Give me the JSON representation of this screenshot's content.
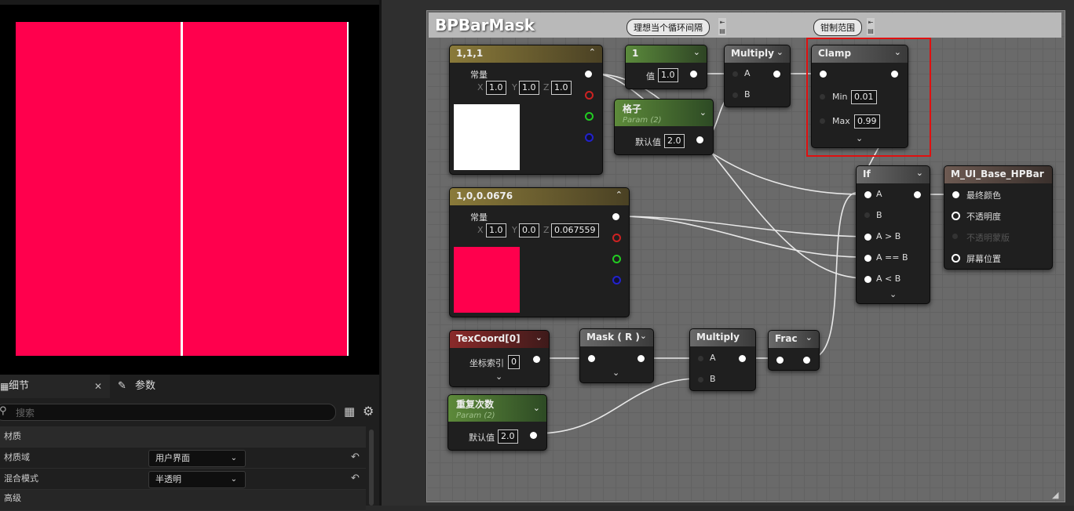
{
  "preview": {
    "fill_color": "#ff004d"
  },
  "details_panel": {
    "tabs": [
      {
        "label": "细节",
        "icon": "details-icon"
      },
      {
        "label": "参数",
        "icon": "pencil-icon"
      }
    ],
    "search_placeholder": "搜索",
    "section_header": "材质",
    "rows": [
      {
        "label": "材质域",
        "value": "用户界面"
      },
      {
        "label": "混合模式",
        "value": "半透明"
      }
    ],
    "advanced_label": "高级"
  },
  "graph": {
    "title": "BPBarMask",
    "comments": [
      "理想当个循环间隔",
      "钳制范围"
    ],
    "nodes": {
      "const_white": {
        "title": "1,1,1",
        "type_label": "常量",
        "x_label": "X",
        "x": "1.0",
        "y_label": "Y",
        "y": "1.0",
        "z_label": "Z",
        "z": "1.0",
        "swatch": "#ffffff"
      },
      "const_red": {
        "title": "1,0,0.0676",
        "type_label": "常量",
        "x_label": "X",
        "x": "1.0",
        "y_label": "Y",
        "y": "0.0",
        "z_label": "Z",
        "z": "0.067559",
        "swatch": "#ff004d"
      },
      "one": {
        "title": "1",
        "value_label": "值",
        "value": "1.0"
      },
      "grid_param": {
        "title": "格子",
        "subtitle": "Param (2)",
        "default_label": "默认值",
        "default": "2.0"
      },
      "multiply_top": {
        "title": "Multiply",
        "a": "A",
        "b": "B"
      },
      "clamp": {
        "title": "Clamp",
        "min_label": "Min",
        "min": "0.01",
        "max_label": "Max",
        "max": "0.99"
      },
      "if_node": {
        "title": "If",
        "pins": [
          "A",
          "B",
          "A > B",
          "A == B",
          "A < B"
        ]
      },
      "result": {
        "title": "M_UI_Base_HPBar",
        "pins": [
          "最终颜色",
          "不透明度",
          "不透明蒙版",
          "屏幕位置"
        ]
      },
      "texcoord": {
        "title": "TexCoord[0]",
        "index_label": "坐标索引",
        "index": "0"
      },
      "mask": {
        "title": "Mask ( R )"
      },
      "multiply_bottom": {
        "title": "Multiply",
        "a": "A",
        "b": "B"
      },
      "frac": {
        "title": "Frac"
      },
      "repeat_param": {
        "title": "重复次数",
        "subtitle": "Param (2)",
        "default_label": "默认值",
        "default": "2.0"
      }
    },
    "highlight_color": "#e01010"
  }
}
